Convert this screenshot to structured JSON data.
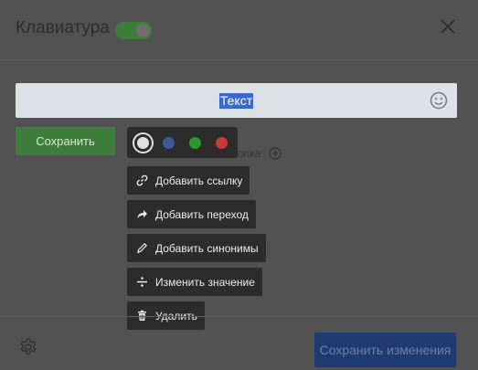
{
  "header": {
    "title": "Клавиатура",
    "toggle_state": "on",
    "toggle_icon": "toggle-switch",
    "close_icon": "close-icon"
  },
  "editor": {
    "text_value": "Текст",
    "emoji_icon": "smile-icon"
  },
  "buttons": {
    "save_label": "Сохранить",
    "new_button_label": "Новая кнопка",
    "new_button_icon": "plus-circle-icon"
  },
  "colors": {
    "options": [
      "white",
      "blue",
      "green",
      "red"
    ],
    "selected": "white",
    "hex": {
      "white": "#e0e0e0",
      "blue": "#3c5a9a",
      "green": "#2b9a2b",
      "red": "#c93a3a"
    }
  },
  "menu": [
    {
      "label": "Добавить ссылку",
      "icon": "link-icon"
    },
    {
      "label": "Добавить переход",
      "icon": "redirect-arrow-icon"
    },
    {
      "label": "Добавить синонимы",
      "icon": "pencil-icon"
    },
    {
      "label": "Изменить значение",
      "icon": "divide-icon"
    },
    {
      "label": "Удалить",
      "icon": "trash-icon"
    }
  ],
  "footer": {
    "settings_icon": "gear-icon",
    "save_changes_label": "Сохранить изменения"
  },
  "accent_colors": {
    "green": "#3d7f3a",
    "blue": "#203a72",
    "background": "#525252",
    "menu_bg": "#2c2c2c"
  }
}
